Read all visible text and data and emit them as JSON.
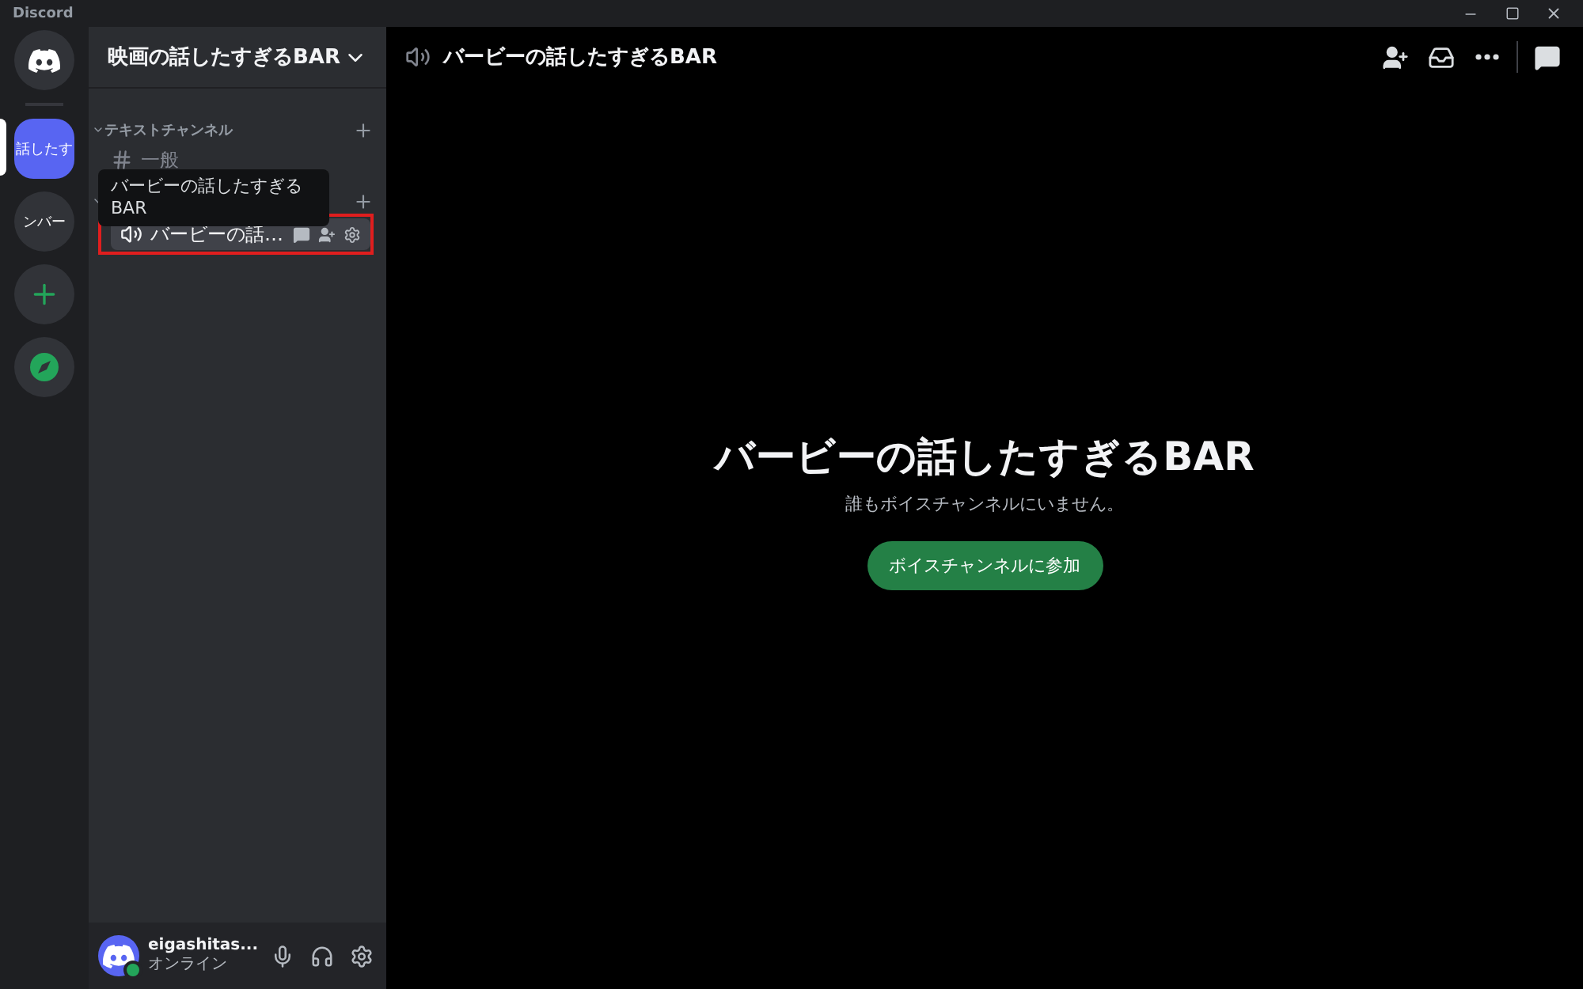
{
  "window": {
    "title": "Discord"
  },
  "servers": [
    {
      "kind": "home",
      "selected": false
    },
    {
      "kind": "server",
      "label": "話したす",
      "selected": true
    },
    {
      "kind": "server",
      "label": "ンバー",
      "selected": false
    },
    {
      "kind": "add",
      "selected": false
    },
    {
      "kind": "explore",
      "selected": false
    }
  ],
  "server_name": "映画の話したすぎるBAR",
  "categories": [
    {
      "name": "テキストチャンネル",
      "expanded": true,
      "channels": [
        {
          "kind": "text",
          "name": "一般",
          "selected": false
        }
      ]
    },
    {
      "expanded": true,
      "channels": [
        {
          "kind": "voice",
          "name": "バービーの話…",
          "selected": true
        }
      ]
    }
  ],
  "tooltip": "バービーの話したすぎるBAR",
  "user": {
    "name": "eigashitas...",
    "status": "オンライン",
    "online": true
  },
  "header": {
    "channel": "バービーの話したすぎるBAR"
  },
  "voice": {
    "title": "バービーの話したすぎるBAR",
    "subtitle": "誰もボイスチャンネルにいません。",
    "join": "ボイスチャンネルに参加"
  }
}
